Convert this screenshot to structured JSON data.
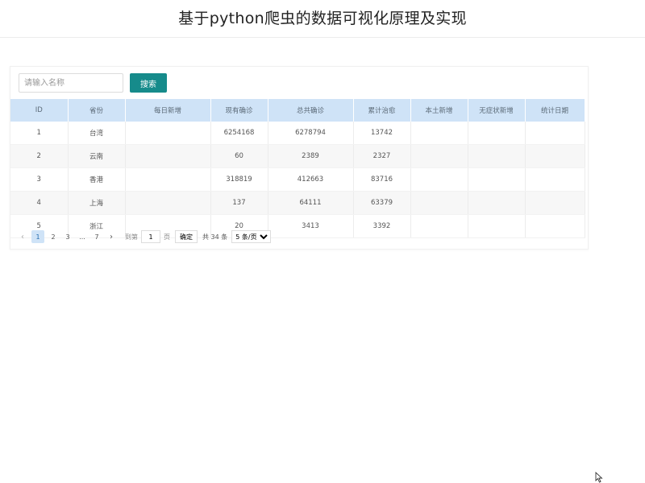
{
  "header": {
    "title": "基于python爬虫的数据可视化原理及实现"
  },
  "search": {
    "placeholder": "请输入名称",
    "value": "",
    "button_label": "搜索"
  },
  "table": {
    "columns": [
      "ID",
      "省份",
      "每日新增",
      "现有确诊",
      "总共确诊",
      "累计治愈",
      "本土新增",
      "无症状新增",
      "统计日期"
    ],
    "rows": [
      [
        "1",
        "台湾",
        "",
        "6254168",
        "6278794",
        "13742",
        "",
        "",
        ""
      ],
      [
        "2",
        "云南",
        "",
        "60",
        "2389",
        "2327",
        "",
        "",
        ""
      ],
      [
        "3",
        "香港",
        "",
        "318819",
        "412663",
        "83716",
        "",
        "",
        ""
      ],
      [
        "4",
        "上海",
        "",
        "137",
        "64111",
        "63379",
        "",
        "",
        ""
      ],
      [
        "5",
        "浙江",
        "",
        "20",
        "3413",
        "3392",
        "",
        "",
        ""
      ]
    ]
  },
  "pagination": {
    "prev_icon": "chevron-left-icon",
    "next_icon": "chevron-right-icon",
    "pages": [
      "1",
      "2",
      "3",
      "...",
      "7"
    ],
    "current_page": "1",
    "goto_label": "到第",
    "goto_value": "1",
    "goto_unit": "页",
    "confirm_label": "确定",
    "total_text": "共 34 条",
    "page_size_options": [
      "5 条/页"
    ],
    "page_size_selected": "5 条/页"
  },
  "colors": {
    "search_button": "#168b8b",
    "table_header": "#cfe3f7",
    "striped_row": "#f7f7f7"
  }
}
